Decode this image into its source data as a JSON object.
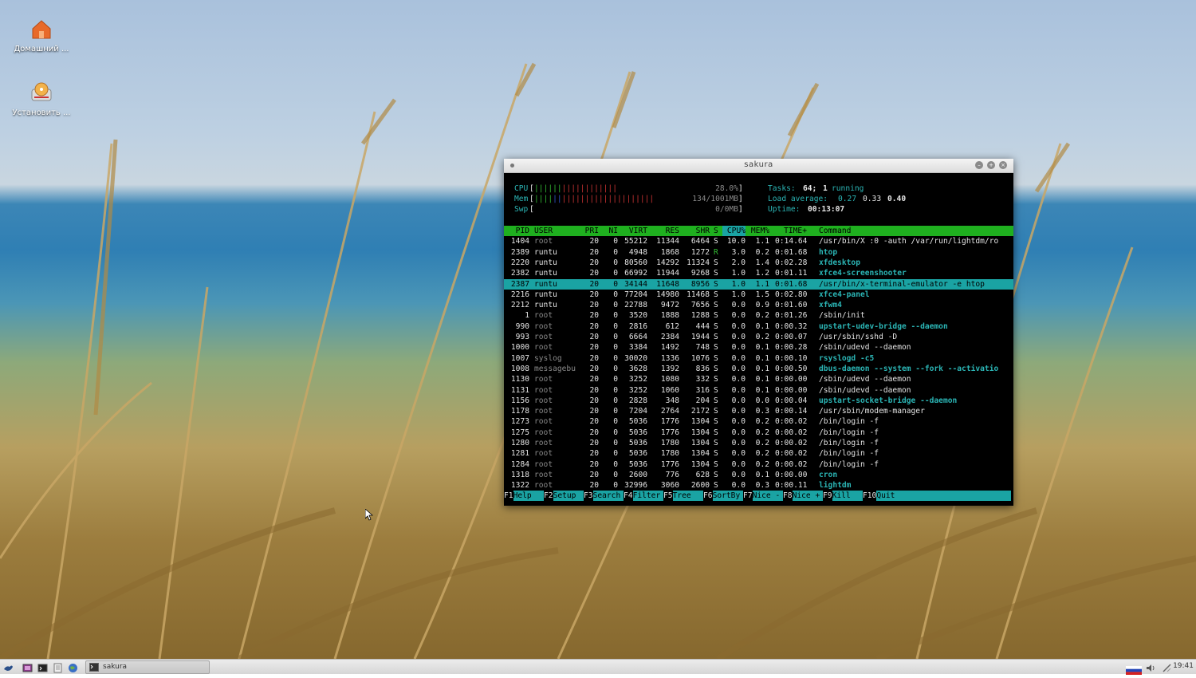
{
  "desktop": {
    "icons": [
      {
        "label": "Домашний ...",
        "icon": "home-folder-icon"
      },
      {
        "label": "Установить ...",
        "icon": "install-disk-icon"
      }
    ]
  },
  "window": {
    "title": "sakura"
  },
  "htop": {
    "meters": {
      "cpu_label": "CPU",
      "cpu_bar": "||||||||||||",
      "cpu_value": "28.0%",
      "mem_label": "Mem",
      "mem_bar": "||||||||||||||||||||",
      "mem_value": "134/1001MB",
      "swp_label": "Swp",
      "swp_value": "0/0MB",
      "tasks_label": "Tasks:",
      "tasks_count": "64;",
      "tasks_running": "1",
      "tasks_running_label": "running",
      "load_label": "Load average:",
      "load1": "0.27",
      "load5": "0.33",
      "load15": "0.40",
      "uptime_label": "Uptime:",
      "uptime": "00:13:07"
    },
    "columns": [
      "PID",
      "USER",
      "PRI",
      "NI",
      "VIRT",
      "RES",
      "SHR",
      "S",
      "CPU%",
      "MEM%",
      "TIME+",
      "Command"
    ],
    "rows": [
      {
        "pid": "1404",
        "user": "root",
        "pri": "20",
        "ni": "0",
        "virt": "55212",
        "res": "11344",
        "shr": "6464",
        "s": "S",
        "cpu": "10.0",
        "mem": "1.1",
        "time": "0:14.64",
        "cmd": "/usr/bin/X :0 -auth /var/run/lightdm/ro"
      },
      {
        "pid": "2389",
        "user": "runtu",
        "pri": "20",
        "ni": "0",
        "virt": "4948",
        "res": "1868",
        "shr": "1272",
        "s": "R",
        "cpu": "3.0",
        "mem": "0.2",
        "time": "0:01.68",
        "cmd": "htop"
      },
      {
        "pid": "2220",
        "user": "runtu",
        "pri": "20",
        "ni": "0",
        "virt": "80560",
        "res": "14292",
        "shr": "11324",
        "s": "S",
        "cpu": "2.0",
        "mem": "1.4",
        "time": "0:02.28",
        "cmd": "xfdesktop"
      },
      {
        "pid": "2382",
        "user": "runtu",
        "pri": "20",
        "ni": "0",
        "virt": "66992",
        "res": "11944",
        "shr": "9268",
        "s": "S",
        "cpu": "1.0",
        "mem": "1.2",
        "time": "0:01.11",
        "cmd": "xfce4-screenshooter"
      },
      {
        "pid": "2387",
        "user": "runtu",
        "pri": "20",
        "ni": "0",
        "virt": "34144",
        "res": "11648",
        "shr": "8956",
        "s": "S",
        "cpu": "1.0",
        "mem": "1.1",
        "time": "0:01.68",
        "cmd": "/usr/bin/x-terminal-emulator -e htop"
      },
      {
        "pid": "2216",
        "user": "runtu",
        "pri": "20",
        "ni": "0",
        "virt": "77204",
        "res": "14980",
        "shr": "11468",
        "s": "S",
        "cpu": "1.0",
        "mem": "1.5",
        "time": "0:02.80",
        "cmd": "xfce4-panel"
      },
      {
        "pid": "2212",
        "user": "runtu",
        "pri": "20",
        "ni": "0",
        "virt": "22788",
        "res": "9472",
        "shr": "7656",
        "s": "S",
        "cpu": "0.0",
        "mem": "0.9",
        "time": "0:01.60",
        "cmd": "xfwm4"
      },
      {
        "pid": "1",
        "user": "root",
        "pri": "20",
        "ni": "0",
        "virt": "3520",
        "res": "1888",
        "shr": "1288",
        "s": "S",
        "cpu": "0.0",
        "mem": "0.2",
        "time": "0:01.26",
        "cmd": "/sbin/init"
      },
      {
        "pid": "990",
        "user": "root",
        "pri": "20",
        "ni": "0",
        "virt": "2816",
        "res": "612",
        "shr": "444",
        "s": "S",
        "cpu": "0.0",
        "mem": "0.1",
        "time": "0:00.32",
        "cmd": "upstart-udev-bridge --daemon"
      },
      {
        "pid": "993",
        "user": "root",
        "pri": "20",
        "ni": "0",
        "virt": "6664",
        "res": "2384",
        "shr": "1944",
        "s": "S",
        "cpu": "0.0",
        "mem": "0.2",
        "time": "0:00.07",
        "cmd": "/usr/sbin/sshd -D"
      },
      {
        "pid": "1000",
        "user": "root",
        "pri": "20",
        "ni": "0",
        "virt": "3384",
        "res": "1492",
        "shr": "748",
        "s": "S",
        "cpu": "0.0",
        "mem": "0.1",
        "time": "0:00.28",
        "cmd": "/sbin/udevd --daemon"
      },
      {
        "pid": "1007",
        "user": "syslog",
        "pri": "20",
        "ni": "0",
        "virt": "30020",
        "res": "1336",
        "shr": "1076",
        "s": "S",
        "cpu": "0.0",
        "mem": "0.1",
        "time": "0:00.10",
        "cmd": "rsyslogd -c5"
      },
      {
        "pid": "1008",
        "user": "messagebu",
        "pri": "20",
        "ni": "0",
        "virt": "3628",
        "res": "1392",
        "shr": "836",
        "s": "S",
        "cpu": "0.0",
        "mem": "0.1",
        "time": "0:00.50",
        "cmd": "dbus-daemon --system --fork --activatio"
      },
      {
        "pid": "1130",
        "user": "root",
        "pri": "20",
        "ni": "0",
        "virt": "3252",
        "res": "1080",
        "shr": "332",
        "s": "S",
        "cpu": "0.0",
        "mem": "0.1",
        "time": "0:00.00",
        "cmd": "/sbin/udevd --daemon"
      },
      {
        "pid": "1131",
        "user": "root",
        "pri": "20",
        "ni": "0",
        "virt": "3252",
        "res": "1060",
        "shr": "316",
        "s": "S",
        "cpu": "0.0",
        "mem": "0.1",
        "time": "0:00.00",
        "cmd": "/sbin/udevd --daemon"
      },
      {
        "pid": "1156",
        "user": "root",
        "pri": "20",
        "ni": "0",
        "virt": "2828",
        "res": "348",
        "shr": "204",
        "s": "S",
        "cpu": "0.0",
        "mem": "0.0",
        "time": "0:00.04",
        "cmd": "upstart-socket-bridge --daemon"
      },
      {
        "pid": "1178",
        "user": "root",
        "pri": "20",
        "ni": "0",
        "virt": "7204",
        "res": "2764",
        "shr": "2172",
        "s": "S",
        "cpu": "0.0",
        "mem": "0.3",
        "time": "0:00.14",
        "cmd": "/usr/sbin/modem-manager"
      },
      {
        "pid": "1273",
        "user": "root",
        "pri": "20",
        "ni": "0",
        "virt": "5036",
        "res": "1776",
        "shr": "1304",
        "s": "S",
        "cpu": "0.0",
        "mem": "0.2",
        "time": "0:00.02",
        "cmd": "/bin/login -f"
      },
      {
        "pid": "1275",
        "user": "root",
        "pri": "20",
        "ni": "0",
        "virt": "5036",
        "res": "1776",
        "shr": "1304",
        "s": "S",
        "cpu": "0.0",
        "mem": "0.2",
        "time": "0:00.02",
        "cmd": "/bin/login -f"
      },
      {
        "pid": "1280",
        "user": "root",
        "pri": "20",
        "ni": "0",
        "virt": "5036",
        "res": "1780",
        "shr": "1304",
        "s": "S",
        "cpu": "0.0",
        "mem": "0.2",
        "time": "0:00.02",
        "cmd": "/bin/login -f"
      },
      {
        "pid": "1281",
        "user": "root",
        "pri": "20",
        "ni": "0",
        "virt": "5036",
        "res": "1780",
        "shr": "1304",
        "s": "S",
        "cpu": "0.0",
        "mem": "0.2",
        "time": "0:00.02",
        "cmd": "/bin/login -f"
      },
      {
        "pid": "1284",
        "user": "root",
        "pri": "20",
        "ni": "0",
        "virt": "5036",
        "res": "1776",
        "shr": "1304",
        "s": "S",
        "cpu": "0.0",
        "mem": "0.2",
        "time": "0:00.02",
        "cmd": "/bin/login -f"
      },
      {
        "pid": "1318",
        "user": "root",
        "pri": "20",
        "ni": "0",
        "virt": "2600",
        "res": "776",
        "shr": "628",
        "s": "S",
        "cpu": "0.0",
        "mem": "0.1",
        "time": "0:00.00",
        "cmd": "cron"
      },
      {
        "pid": "1322",
        "user": "root",
        "pri": "20",
        "ni": "0",
        "virt": "32996",
        "res": "3060",
        "shr": "2600",
        "s": "S",
        "cpu": "0.0",
        "mem": "0.3",
        "time": "0:00.11",
        "cmd": "lightdm"
      }
    ],
    "selected_row": 4,
    "fkeys": [
      {
        "key": "F1",
        "label": "Help  "
      },
      {
        "key": "F2",
        "label": "Setup "
      },
      {
        "key": "F3",
        "label": "Search"
      },
      {
        "key": "F4",
        "label": "Filter"
      },
      {
        "key": "F5",
        "label": "Tree  "
      },
      {
        "key": "F6",
        "label": "SortBy"
      },
      {
        "key": "F7",
        "label": "Nice -"
      },
      {
        "key": "F8",
        "label": "Nice +"
      },
      {
        "key": "F9",
        "label": "Kill  "
      },
      {
        "key": "F10",
        "label": "Quit"
      }
    ]
  },
  "taskbar": {
    "task_label": "sakura",
    "clock": "19:41",
    "launchers": [
      "xfce-menu-icon",
      "app-launcher-icon",
      "terminal-launcher-icon",
      "file-manager-icon",
      "web-browser-icon"
    ],
    "tray": [
      "russian-flag-icon",
      "volume-icon",
      "network-icon"
    ]
  },
  "colors": {
    "term_bg": "#000000",
    "header_green": "#1fb01f",
    "selection_cyan": "#1aa3a3",
    "accent_cyan": "#2bb5b5"
  }
}
